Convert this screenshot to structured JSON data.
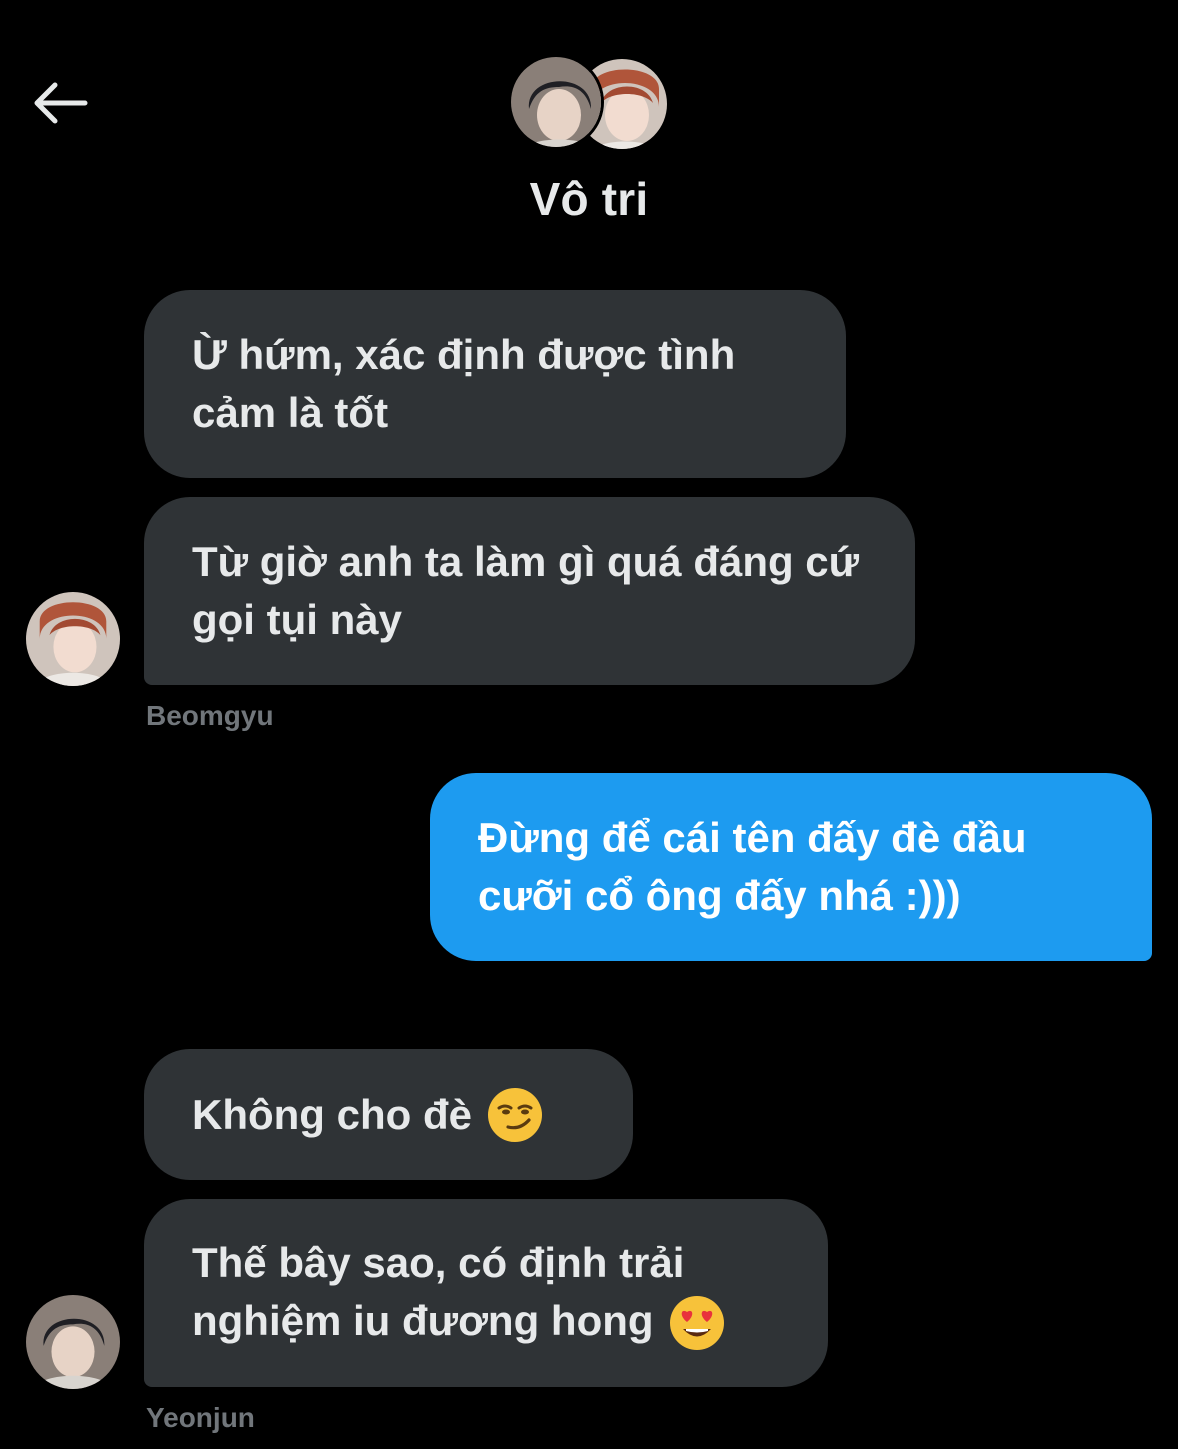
{
  "header": {
    "title": "Vô tri",
    "back_icon": "arrow-left-icon"
  },
  "messages": [
    {
      "direction": "incoming",
      "text": "Ừ hứm, xác định được tình cảm là tốt"
    },
    {
      "direction": "incoming",
      "text": "Từ giờ anh ta làm gì quá đáng cứ gọi tụi này",
      "sender": "Beomgyu"
    },
    {
      "direction": "outgoing",
      "text": "Đừng để cái tên đấy đè đầu cưỡi cổ ông đấy nhá :)))"
    },
    {
      "direction": "incoming",
      "text": "Không cho đè",
      "emoji": "smirking-face-icon"
    },
    {
      "direction": "incoming",
      "text": "Thế bây sao, có định trải nghiệm iu đương hong",
      "emoji": "heart-eyes-face-icon",
      "sender": "Yeonjun"
    }
  ],
  "colors": {
    "background": "#000000",
    "incoming_bubble": "#2f3336",
    "outgoing_bubble": "#1d9bf0",
    "text": "#e7e9ea",
    "muted": "#71767b"
  }
}
